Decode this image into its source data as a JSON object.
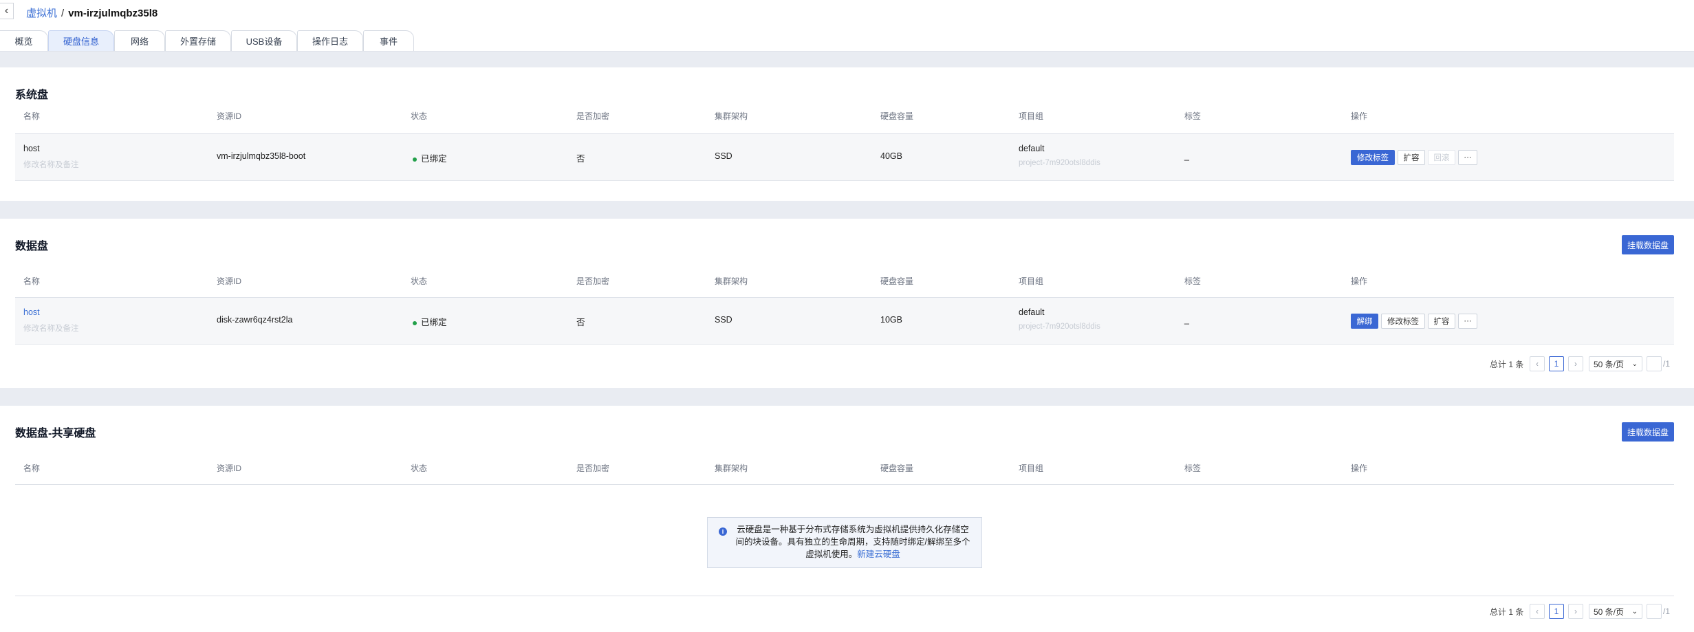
{
  "breadcrumb": {
    "parent": "虚拟机",
    "separator": "/",
    "current": "vm-irzjulmqbz35l8"
  },
  "tabs": [
    {
      "label": "概览"
    },
    {
      "label": "硬盘信息"
    },
    {
      "label": "网络"
    },
    {
      "label": "外置存储"
    },
    {
      "label": "USB设备"
    },
    {
      "label": "操作日志"
    },
    {
      "label": "事件"
    }
  ],
  "active_tab": "硬盘信息",
  "columns": [
    "名称",
    "资源ID",
    "状态",
    "是否加密",
    "集群架构",
    "硬盘容量",
    "项目组",
    "标签",
    "操作"
  ],
  "system_disk": {
    "title": "系统盘",
    "row": {
      "name": "host",
      "note": "修改名称及备注",
      "resource_id": "vm-irzjulmqbz35l8-boot",
      "status": "已绑定",
      "encrypted": "否",
      "arch": "SSD",
      "capacity": "40GB",
      "project": "default",
      "project_id": "project-7m920otsl8ddis",
      "tag": "_",
      "actions": [
        "修改标签",
        "扩容",
        "回滚",
        "···"
      ]
    }
  },
  "data_disk": {
    "title": "数据盘",
    "mount_button": "挂载数据盘",
    "row": {
      "name": "host",
      "note": "修改名称及备注",
      "resource_id": "disk-zawr6qz4rst2la",
      "status": "已绑定",
      "encrypted": "否",
      "arch": "SSD",
      "capacity": "10GB",
      "project": "default",
      "project_id": "project-7m920otsl8ddis",
      "tag": "_",
      "actions": [
        "解绑",
        "修改标签",
        "扩容",
        "···"
      ]
    },
    "pagination": {
      "total": "总计 1 条",
      "prev": "‹",
      "page": "1",
      "next": "›",
      "page_size": "50 条/页",
      "of_pages": "/1"
    }
  },
  "shared_disk": {
    "title": "数据盘-共享硬盘",
    "mount_button": "挂载数据盘",
    "empty_text": "云硬盘是一种基于分布式存储系统为虚拟机提供持久化存储空间的块设备。具有独立的生命周期，支持随时绑定/解绑至多个虚拟机使用。",
    "empty_link": "新建云硬盘",
    "pagination": {
      "total": "总计 1 条",
      "prev": "‹",
      "page": "1",
      "next": "›",
      "page_size": "50 条/页",
      "of_pages": "/1"
    }
  },
  "colors": {
    "accent": "#3a67d4",
    "status_ok": "#22a04a"
  }
}
